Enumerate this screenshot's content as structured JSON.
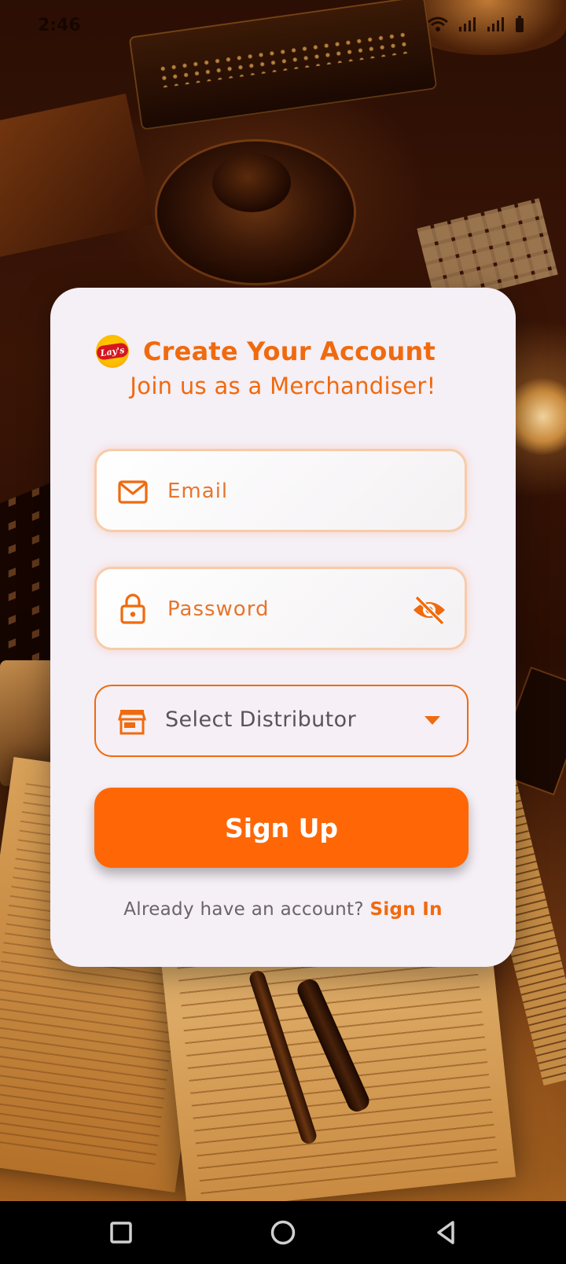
{
  "status_bar": {
    "time": "2:46",
    "icons": [
      "wifi-icon",
      "signal-icon",
      "signal-icon",
      "battery-icon"
    ]
  },
  "brand": {
    "logo_text": "Lay's",
    "accent_color": "#f06a0e",
    "button_color": "#ff6706"
  },
  "header": {
    "title": "Create Your Account",
    "subtitle": "Join us as a Merchandiser!"
  },
  "form": {
    "email": {
      "placeholder": "Email",
      "value": "",
      "icon": "mail-icon"
    },
    "password": {
      "placeholder": "Password",
      "value": "",
      "icon": "lock-icon",
      "toggle_icon": "eye-off-icon"
    },
    "distributor": {
      "selected": "Select Distributor",
      "icon": "store-icon"
    },
    "submit_label": "Sign Up"
  },
  "footer": {
    "prompt": "Already have an account?",
    "link_label": "Sign In"
  },
  "nav_bar": {
    "buttons": [
      "recents-icon",
      "home-icon",
      "back-icon"
    ]
  }
}
